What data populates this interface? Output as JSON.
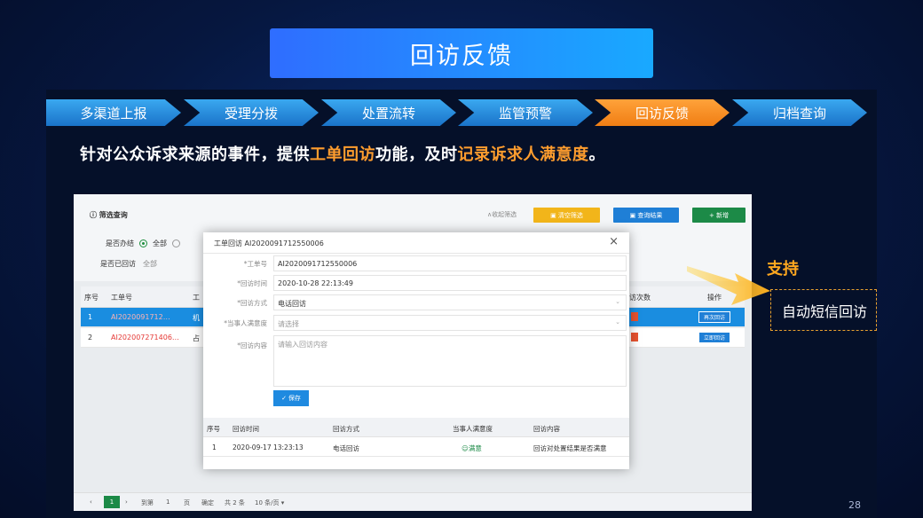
{
  "title": "回访反馈",
  "steps": [
    "多渠道上报",
    "受理分拨",
    "处置流转",
    "监管预警",
    "回访反馈",
    "归档查询"
  ],
  "description": {
    "part1": "针对公众诉求来源的事件，提供",
    "hl1": "工单回访",
    "part2": "功能，及时",
    "hl2": "记录诉求人满意度",
    "part3": "。"
  },
  "bg": {
    "filter_title": "ⓘ 筛选查询",
    "row1_label": "是否办结",
    "row1_opt": "全部",
    "row2_label": "是否已回访",
    "row2_val": "全部",
    "collapse": "∧收起筛选",
    "btn_reset": "▣ 清空筛选",
    "btn_query": "▣ 查询结果",
    "btn_new": "+ 新增",
    "col_seq": "序号",
    "col_no": "工单号",
    "col_x": "工",
    "col_count": "访次数",
    "col_op": "操作",
    "rows": [
      {
        "seq": "1",
        "no": "AI2020091712…",
        "x": "机",
        "badge": "1",
        "op": "再次回访"
      },
      {
        "seq": "2",
        "no": "AI202007271406…",
        "x": "占",
        "badge": "0",
        "op": "立即回访"
      }
    ],
    "pager": {
      "cur": "1",
      "goto": "到第",
      "page": "1",
      "unit": "页",
      "ok": "确定",
      "total": "共 2 条",
      "size": "10 条/页 ▾"
    }
  },
  "modal": {
    "title": "工单回访 AI2020091712550006",
    "close": "×",
    "fields": [
      {
        "label": "*工单号",
        "value": "AI2020091712550006"
      },
      {
        "label": "*回访时间",
        "value": "2020-10-28 22:13:49"
      },
      {
        "label": "*回访方式",
        "value": "电话回访"
      },
      {
        "label": "*当事人满意度",
        "value": "请选择"
      }
    ],
    "content_label": "*回访内容",
    "content_placeholder": "请输入回访内容",
    "save": "保存",
    "record_head": [
      "序号",
      "回访时间",
      "回访方式",
      "当事人满意度",
      "回访内容"
    ],
    "record": {
      "seq": "1",
      "time": "2020-09-17 13:23:13",
      "way": "电话回访",
      "sat": "☺满意",
      "content": "回访对处置结果是否满意"
    }
  },
  "support": "支持",
  "auto_sms": "自动短信回访",
  "page_number": "28",
  "colors": {
    "accent_orange": "#f07e14",
    "step_blue": "#1a73c9",
    "title_blue": "#2f6dff"
  }
}
